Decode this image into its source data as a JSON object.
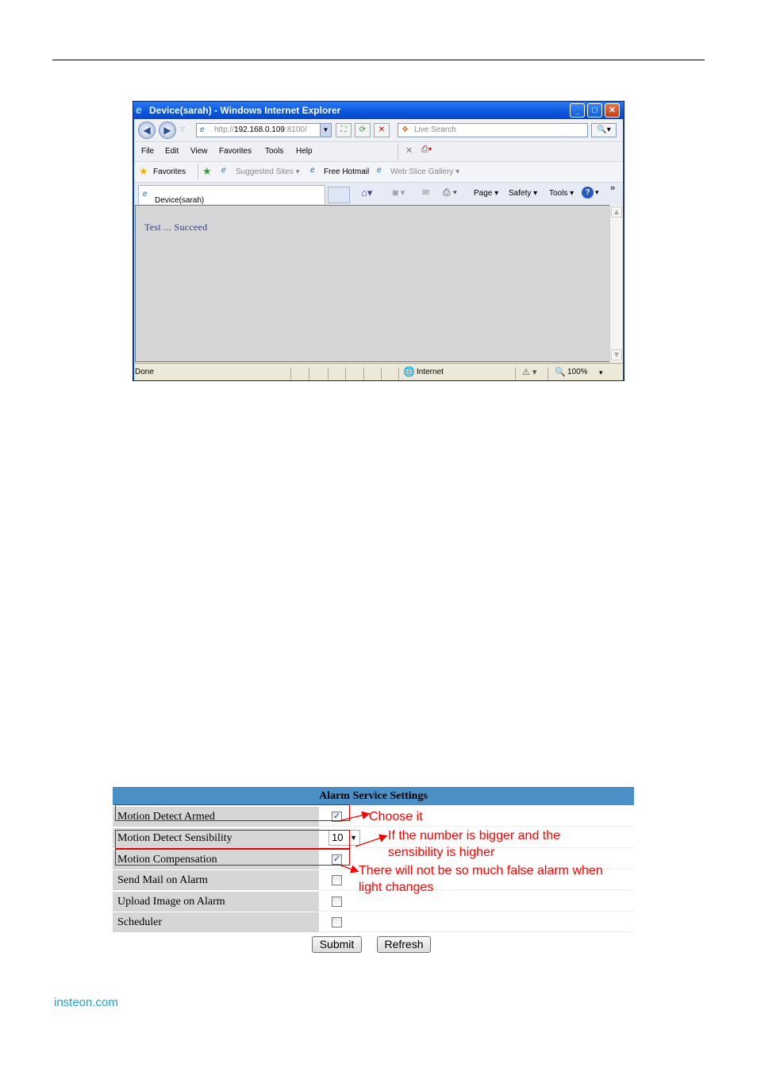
{
  "browser": {
    "title": "Device(sarah) - Windows Internet Explorer",
    "address_prefix": "http://",
    "address_host": "192.168.0.109",
    "address_port": ":8100/",
    "search_placeholder": "Live Search",
    "menu": [
      "File",
      "Edit",
      "View",
      "Favorites",
      "Tools",
      "Help"
    ],
    "favorites": {
      "label": "Favorites",
      "suggested": "Suggested Sites ▾",
      "hotmail": "Free Hotmail",
      "webslice": "Web Slice Gallery ▾"
    },
    "tab_label": "Device(sarah)",
    "command_bar": {
      "page": "Page ▾",
      "safety": "Safety ▾",
      "tools": "Tools ▾",
      "more": "»"
    },
    "content_text": "Test ... Succeed",
    "status": {
      "done": "Done",
      "zone": "Internet",
      "zoom": "100%"
    }
  },
  "alarm": {
    "title": "Alarm Service Settings",
    "rows": [
      {
        "label": "Motion Detect Armed",
        "checked": true
      },
      {
        "label": "Motion Detect Sensibility",
        "value": "10"
      },
      {
        "label": "Motion Compensation",
        "checked": true
      },
      {
        "label": "Send Mail on Alarm",
        "checked": false
      },
      {
        "label": "Upload Image on Alarm",
        "checked": false
      },
      {
        "label": "Scheduler",
        "checked": false
      }
    ],
    "submit_label": "Submit",
    "refresh_label": "Refresh"
  },
  "annotations": {
    "choose": "Choose it",
    "sensibility_line1": "If the number is bigger and the",
    "sensibility_line2": "sensibility is higher",
    "compensation_line1": "There will not be so much false alarm when",
    "compensation_line2": "light changes"
  },
  "footer": "insteon.com",
  "colors": {
    "annotation": "#ff0000",
    "table_header": "#4a8fc6",
    "footer_link": "#1ea0d6"
  }
}
